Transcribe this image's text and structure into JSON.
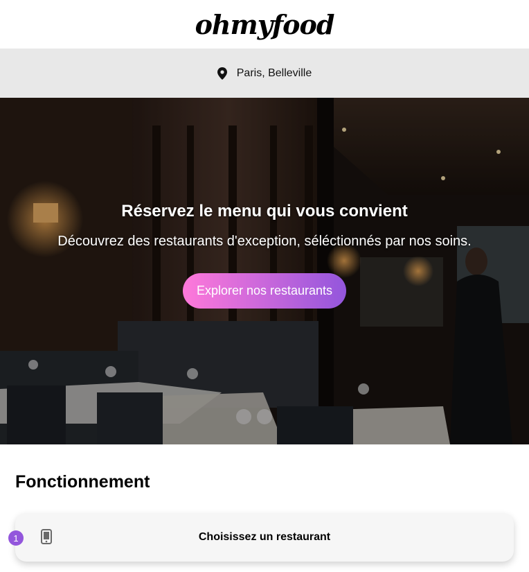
{
  "header": {
    "logo_text": "ohmyfood"
  },
  "location": {
    "icon": "map-pin-icon",
    "text": "Paris, Belleville"
  },
  "hero": {
    "title": "Réservez le menu qui vous convient",
    "subtitle": "Découvrez des restaurants d'exception, séléctionnés par nos soins.",
    "button_label": "Explorer nos restaurants"
  },
  "how_it_works": {
    "title": "Fonctionnement",
    "steps": [
      {
        "number": "1",
        "icon": "smartphone-icon",
        "label": "Choisissez un restaurant"
      }
    ]
  },
  "colors": {
    "accent_primary": "#9356dc",
    "accent_secondary": "#ff79da",
    "location_bar": "#e8e8e8"
  }
}
